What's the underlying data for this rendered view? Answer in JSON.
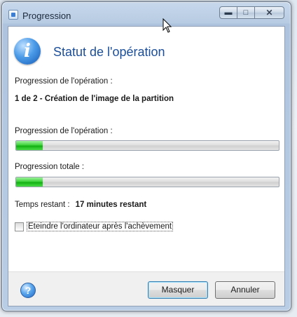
{
  "window": {
    "title": "Progression"
  },
  "header": {
    "title": "Statut de l'opération"
  },
  "operation": {
    "label": "Progression de l'opération :",
    "current_step": "1 de 2 - Création de l'image de la partition"
  },
  "operation_progress": {
    "label": "Progression de l'opération :",
    "percent": 10
  },
  "total_progress": {
    "label": "Progression totale :",
    "percent": 10
  },
  "time_remaining": {
    "label": "Temps restant :",
    "value": "17 minutes restant"
  },
  "shutdown_option": {
    "label": "Eteindre l'ordinateur après l'achèvement",
    "checked": false
  },
  "buttons": {
    "hide": "Masquer",
    "cancel": "Annuler"
  },
  "icons": {
    "window": "window-icon",
    "info": "info-icon",
    "help": "help-icon",
    "cursor": "mouse-cursor-icon"
  },
  "colors": {
    "accent": "#1b4e9a",
    "progress_fill": "#2ecb2b"
  }
}
